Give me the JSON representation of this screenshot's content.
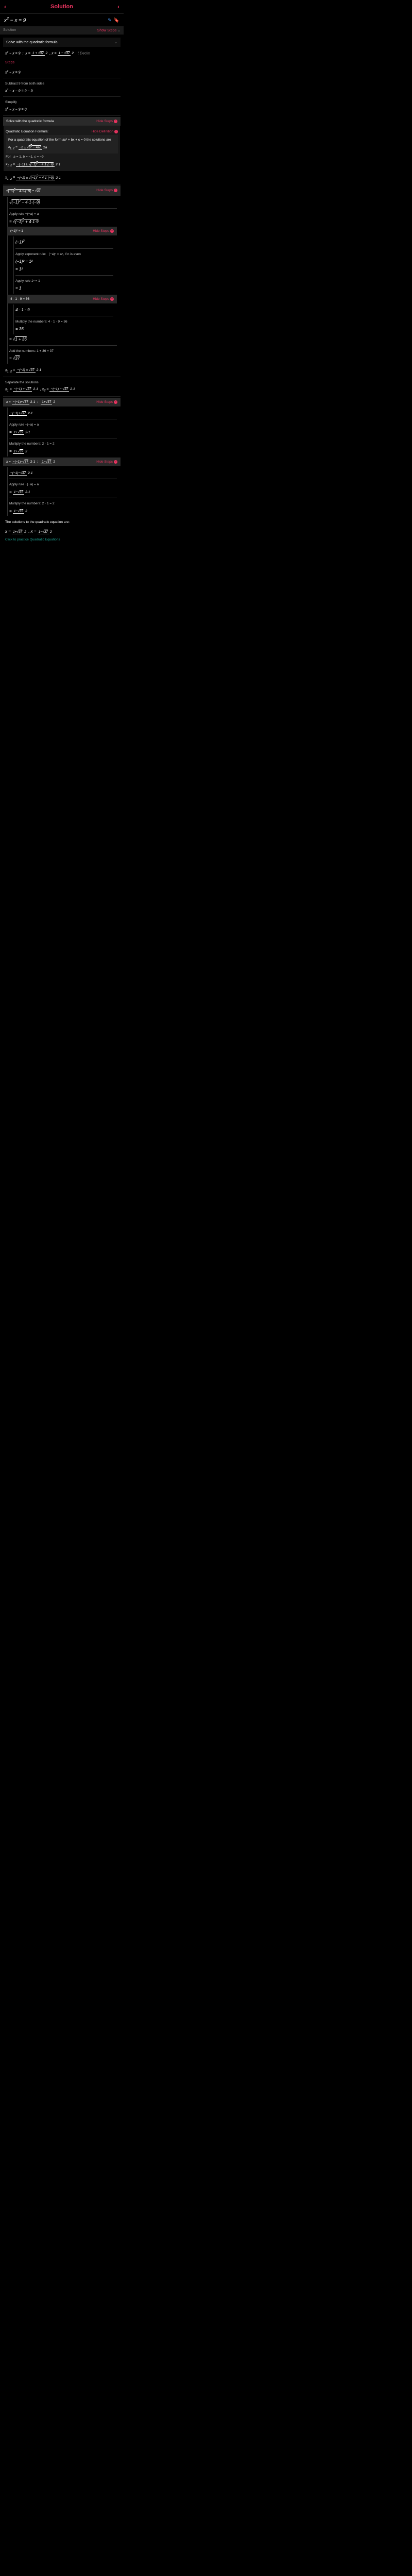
{
  "header": {
    "title": "Solution"
  },
  "equation": "x² − x = 9",
  "tabs": {
    "solution": "Solution",
    "show_steps": "Show Steps"
  },
  "method": {
    "label": "Solve with the quadratic formula"
  },
  "result": {
    "lhs": "x² − x = 9",
    "sep": ":",
    "solution_prefix": "x =",
    "decim": "( Decim"
  },
  "steps_label": "Steps",
  "s1": {
    "eq": "x² − x = 9",
    "desc": "Subtract 9 from both sides",
    "eq2": "x² − x − 9 = 9 − 9",
    "simp": "Simplify",
    "eq3": "x² − x − 9 = 0"
  },
  "quad": {
    "header": "Solve with the quadratic formula",
    "hide": "Hide Steps"
  },
  "qdef": {
    "title": "Quadratic Equation Formula:",
    "hide_def": "Hide Definition",
    "text1": "For a quadratic equation of the form ax² + bx + c = 0 the solutions are",
    "for": "For",
    "vals": "a = 1, b = −1, c = −9"
  },
  "discr": {
    "hide": "Hide Steps",
    "apply_rule": "Apply rule  −(−a) = a"
  },
  "sq1": {
    "val": "(−1)² = 1",
    "hide": "Hide Steps",
    "exp_rule": "Apply exponent rule:",
    "rule_text": "(−a)ⁿ = aⁿ, if n is even",
    "r1": "(−1)² = 1²",
    "r2": "= 1²",
    "apply1": "Apply rule 1ᵃ = 1",
    "r3": "= 1"
  },
  "mul": {
    "val": "4 · 1 · 9 = 36",
    "hide": "Hide Steps",
    "expr": "4 · 1 · 9",
    "desc": "Multiply the numbers: 4 · 1 · 9 = 36",
    "res": "= 36"
  },
  "add": {
    "eq": "= √(1 + 36)",
    "desc": "Add the numbers: 1 + 36 = 37",
    "res": "= √37"
  },
  "sep": {
    "desc": "Separate the solutions"
  },
  "x1box": {
    "hide": "Hide Steps",
    "apply": "Apply rule  −(−a) = a",
    "mult": "Multiply the numbers: 2 · 1 = 2"
  },
  "x2box": {
    "hide": "Hide Steps",
    "apply": "Apply rule  −(−a) = a",
    "mult": "Multiply the numbers: 2 · 1 = 2"
  },
  "final": {
    "text": "The solutions to the quadratic equation are:"
  },
  "practice": "Click to practice Quadratic Equations"
}
